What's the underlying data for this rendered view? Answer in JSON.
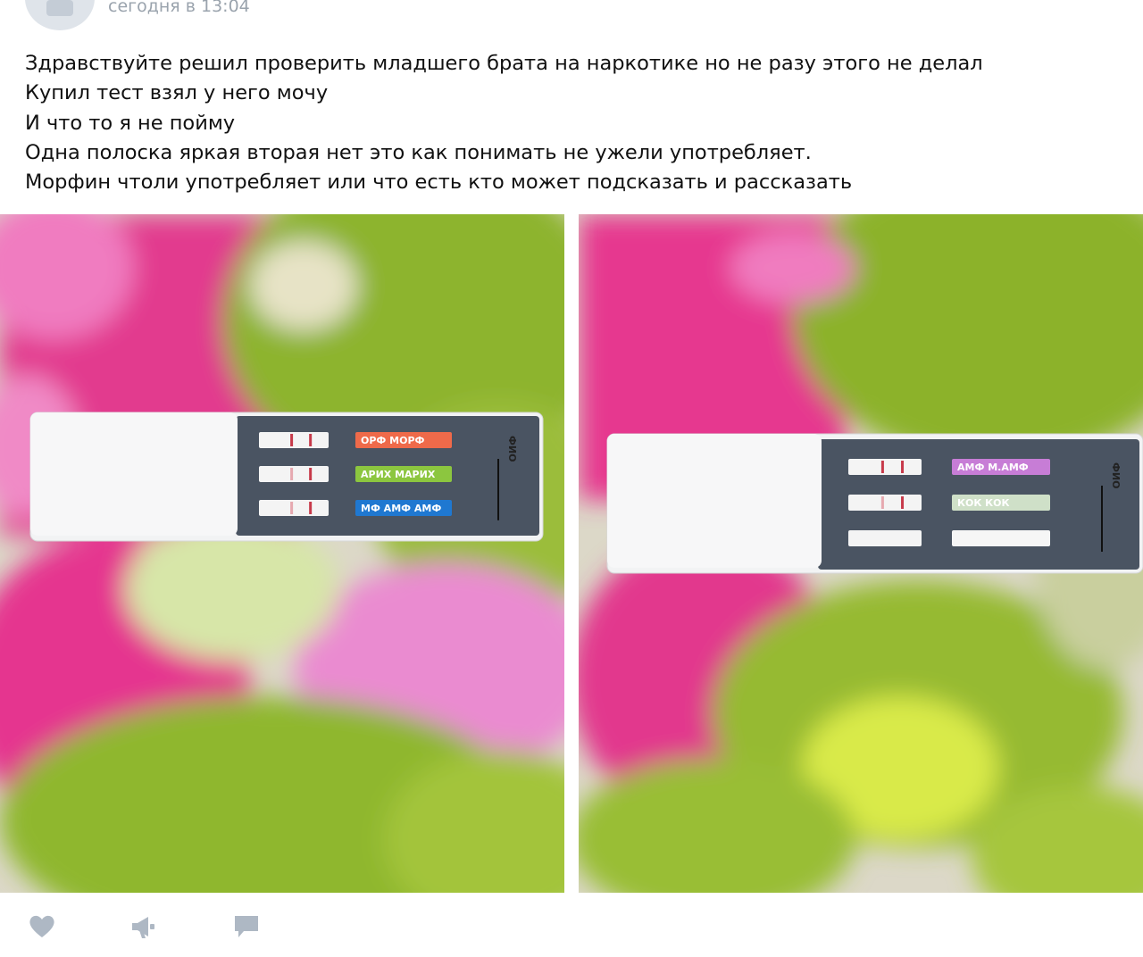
{
  "post": {
    "timestamp": "сегодня в 13:04",
    "lines": [
      "Здравствуйте решил проверить младшего брата на наркотике но не разу этого не делал",
      "Купил тест взял у него мочу",
      "И что то я не пойму",
      "Одна полоска яркая вторая нет это как понимать не ужели употребляет.",
      "Морфин чтоли употребляет или что есть кто может подсказать и рассказать"
    ]
  },
  "photo1": {
    "strips": [
      {
        "label": "ОРФ  МОРФ",
        "color": "#ef6a4a"
      },
      {
        "label": "АРИХ  МАРИХ",
        "color": "#8cc63f"
      },
      {
        "label": "МФ  АМФ  АМФ",
        "color": "#1f78d1"
      }
    ],
    "side_label": "ФИО"
  },
  "photo2": {
    "strips": [
      {
        "label": "АМФ  М.АМФ",
        "color": "#c77dd6"
      },
      {
        "label": "КОК  КОК",
        "color": "#cfe0c8"
      },
      {
        "label": "",
        "color": "#f6f6f6"
      }
    ],
    "side_label": "ФИО"
  },
  "actions": [
    "like-icon",
    "share-icon",
    "comment-icon"
  ],
  "colors": {
    "icon": "#aeb8c4",
    "timestamp": "#9aa3ad",
    "pink": "#e0338a",
    "green": "#8fb52e"
  }
}
